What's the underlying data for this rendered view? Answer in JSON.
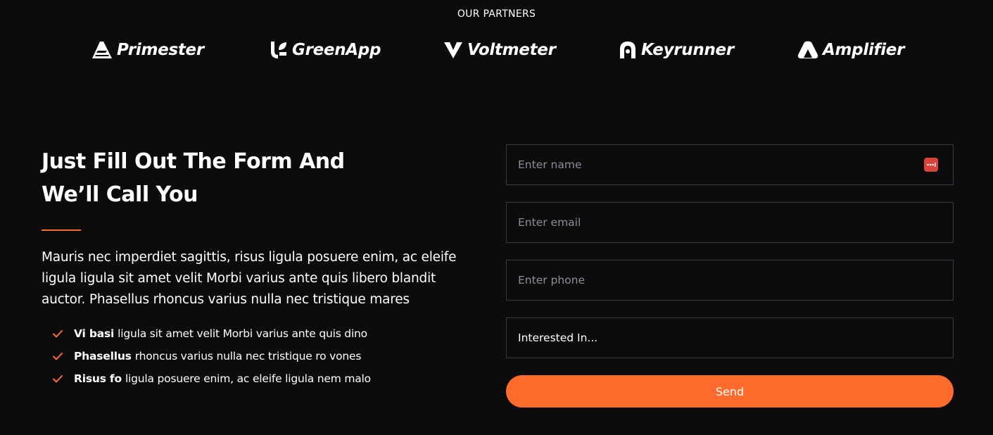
{
  "partners": {
    "title": "OUR PARTNERS",
    "logos": [
      {
        "name": "Primester",
        "icon": "triangle-stripes-icon"
      },
      {
        "name": "GreenApp",
        "icon": "u-leaf-icon"
      },
      {
        "name": "Voltmeter",
        "icon": "v-chevron-icon"
      },
      {
        "name": "Keyrunner",
        "icon": "k-loop-icon"
      },
      {
        "name": "Amplifier",
        "icon": "a-mountain-icon"
      }
    ]
  },
  "contact": {
    "heading_line1": "Just Fill Out The Form And",
    "heading_line2": "We’ll Call You",
    "intro_line1": "Mauris nec imperdiet sagittis, risus ligula posuere enim, ac eleife",
    "intro_line2": "ligula ligula sit amet velit Morbi varius ante quis libero blandit",
    "intro_line3": "auctor. Phasellus rhoncus varius nulla nec tristique mares",
    "features": [
      {
        "bold": "Vi basi",
        "text": "ligula sit amet velit Morbi varius ante quis dino"
      },
      {
        "bold": "Phasellus",
        "text": "rhoncus varius nulla nec tristique ro vones"
      },
      {
        "bold": "Risus fo",
        "text": "ligula posuere enim, ac eleife ligula nem malo"
      }
    ],
    "accent_color": "#ff6b2c"
  },
  "form": {
    "name_placeholder": "Enter name",
    "email_placeholder": "Enter email",
    "phone_placeholder": "Enter phone",
    "interest_value": "Interested In...",
    "submit_label": "Send",
    "password_manager_icon": "password-manager-icon"
  }
}
